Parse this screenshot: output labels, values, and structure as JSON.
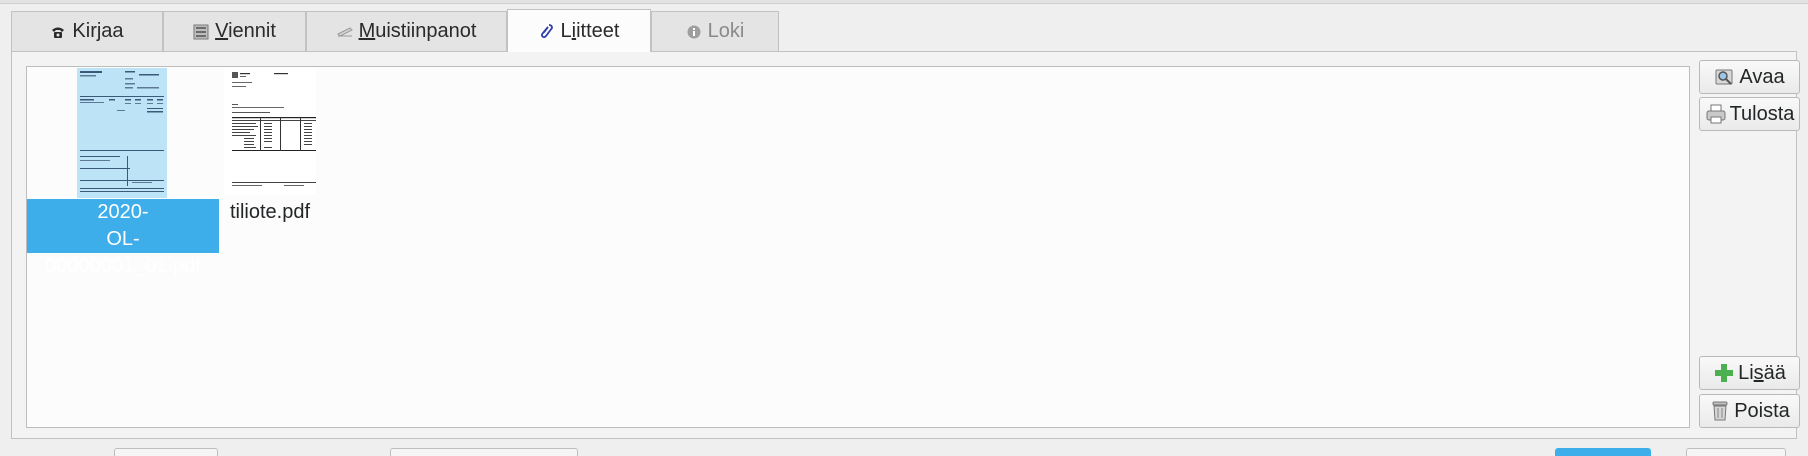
{
  "tabs": [
    {
      "label_first": "",
      "label_underlined": "",
      "label_rest": "Kirjaa",
      "icon": "phone-icon",
      "state": "normal"
    },
    {
      "label_first": "",
      "label_underlined": "V",
      "label_rest": "iennit",
      "icon": "list-icon",
      "state": "normal"
    },
    {
      "label_first": "",
      "label_underlined": "M",
      "label_rest": "uistiinpanot",
      "icon": "note-icon",
      "state": "normal"
    },
    {
      "label_first": "L",
      "label_underlined": "i",
      "label_rest": "itteet",
      "icon": "paperclip-icon",
      "state": "active"
    },
    {
      "label_first": "",
      "label_underlined": "",
      "label_rest": "Loki",
      "icon": "info-icon",
      "state": "disabled"
    }
  ],
  "attachments": [
    {
      "line1": "2020-",
      "line2": "OL-00000001_01.pdf",
      "selected": true
    },
    {
      "line1": "tiliote.pdf",
      "line2": "",
      "selected": false
    }
  ],
  "buttons": {
    "open": "Avaa",
    "print": "Tulosta",
    "add_prefix": "Li",
    "add_underlined": "s",
    "add_suffix": "ää",
    "delete": "Poista"
  },
  "colors": {
    "selection": "#3daee9",
    "thumb_selected_bg": "#bde3f7",
    "add_icon": "#4caf50"
  }
}
